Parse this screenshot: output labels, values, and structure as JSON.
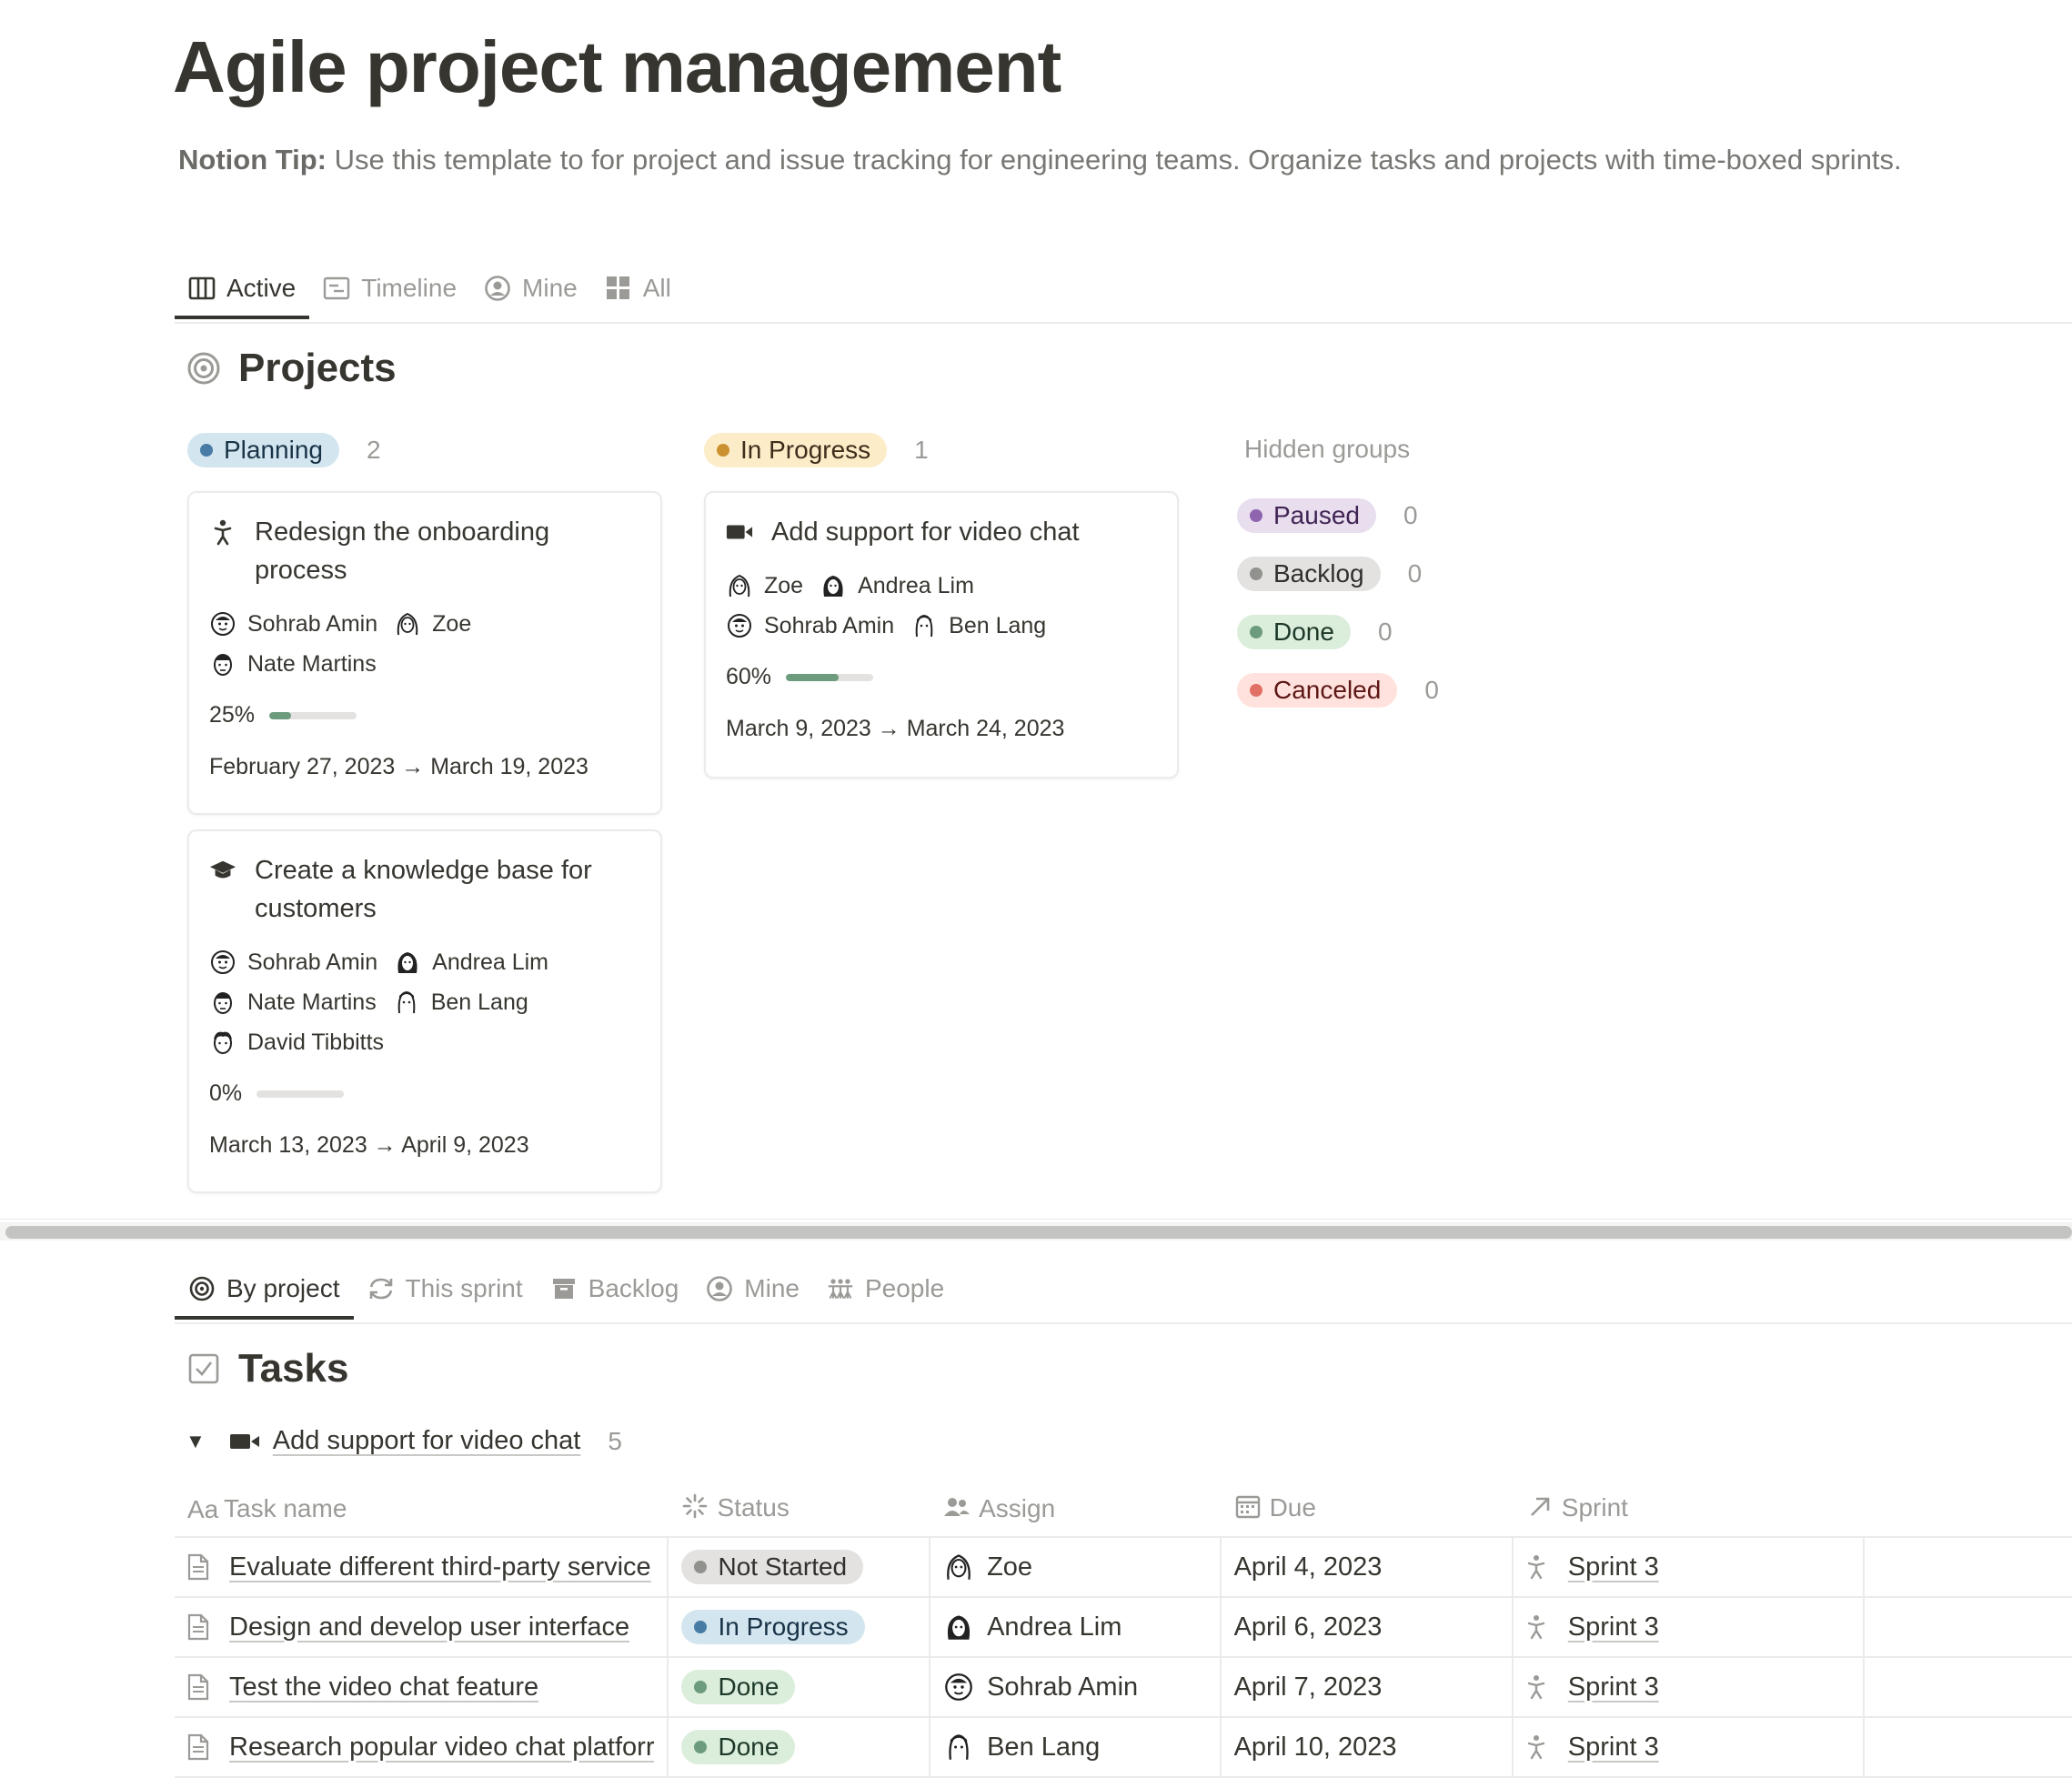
{
  "page": {
    "title": "Agile project management",
    "tip_label": "Notion Tip:",
    "tip_text": " Use this template to for project and issue tracking for engineering teams. Organize tasks and projects with time-boxed sprints."
  },
  "project_tabs": [
    {
      "label": "Active",
      "icon": "board-icon",
      "active": true
    },
    {
      "label": "Timeline",
      "icon": "timeline-icon",
      "active": false
    },
    {
      "label": "Mine",
      "icon": "user-circle-icon",
      "active": false
    },
    {
      "label": "All",
      "icon": "grid-icon",
      "active": false
    }
  ],
  "projects": {
    "title": "Projects",
    "icon": "target-icon",
    "groups": [
      {
        "name": "Planning",
        "count": "2",
        "color": "#d3e5ef",
        "dot": "#487ca5",
        "text_color": "#183347",
        "cards": [
          {
            "title": "Redesign the onboarding process",
            "icon": "person-icon",
            "people": [
              "Sohrab Amin",
              "Zoe",
              "Nate Martins"
            ],
            "progress_label": "25%",
            "progress": 0.25,
            "dates": "February 27, 2023 → March 19, 2023"
          },
          {
            "title": "Create a knowledge base for customers",
            "icon": "graduation-cap-icon",
            "people": [
              "Sohrab Amin",
              "Andrea Lim",
              "Nate Martins",
              "Ben Lang",
              "David Tibbitts"
            ],
            "progress_label": "0%",
            "progress": 0,
            "dates": "March 13, 2023 → April 9, 2023"
          }
        ]
      },
      {
        "name": "In Progress",
        "count": "1",
        "color": "#fdecc8",
        "dot": "#cb912f",
        "text_color": "#402c1b",
        "cards": [
          {
            "title": "Add support for video chat",
            "icon": "video-camera-icon",
            "people": [
              "Zoe",
              "Andrea Lim",
              "Sohrab Amin",
              "Ben Lang"
            ],
            "progress_label": "60%",
            "progress": 0.6,
            "dates": "March 9, 2023 → March 24, 2023"
          }
        ]
      }
    ],
    "hidden_label": "Hidden groups",
    "hidden_groups": [
      {
        "name": "Paused",
        "count": "0",
        "color": "#e8deee",
        "dot": "#9065b0",
        "text_color": "#412454"
      },
      {
        "name": "Backlog",
        "count": "0",
        "color": "#e3e2e0",
        "dot": "#91918e",
        "text_color": "#32302c"
      },
      {
        "name": "Done",
        "count": "0",
        "color": "#dbeddb",
        "dot": "#6c9b7d",
        "text_color": "#1c3829"
      },
      {
        "name": "Canceled",
        "count": "0",
        "color": "#ffe2dd",
        "dot": "#e16f64",
        "text_color": "#5d1715"
      }
    ]
  },
  "task_tabs": [
    {
      "label": "By project",
      "icon": "target-icon",
      "active": true
    },
    {
      "label": "This sprint",
      "icon": "refresh-icon",
      "active": false
    },
    {
      "label": "Backlog",
      "icon": "archive-icon",
      "active": false
    },
    {
      "label": "Mine",
      "icon": "user-circle-icon",
      "active": false
    },
    {
      "label": "People",
      "icon": "people-icon",
      "active": false
    }
  ],
  "tasks": {
    "title": "Tasks",
    "icon": "checkbox-icon",
    "group": {
      "name": "Add support for video chat",
      "count": "5",
      "icon": "video-camera-icon"
    },
    "columns": [
      {
        "label": "Task name",
        "icon": "Aa"
      },
      {
        "label": "Status",
        "icon": "status-icon"
      },
      {
        "label": "Assign",
        "icon": "people-icon"
      },
      {
        "label": "Due",
        "icon": "calendar-icon"
      },
      {
        "label": "Sprint",
        "icon": "relation-arrow-icon"
      }
    ],
    "rows": [
      {
        "name": "Evaluate different third-party service",
        "status": "Not Started",
        "status_bg": "#e3e2e0",
        "status_dot": "#91918e",
        "status_fg": "#32302c",
        "assignee": "Zoe",
        "due": "April 4, 2023",
        "sprint": "Sprint 3"
      },
      {
        "name": "Design and develop user interface",
        "status": "In Progress",
        "status_bg": "#d3e5ef",
        "status_dot": "#487ca5",
        "status_fg": "#183347",
        "assignee": "Andrea Lim",
        "due": "April 6, 2023",
        "sprint": "Sprint 3"
      },
      {
        "name": "Test the video chat feature",
        "status": "Done",
        "status_bg": "#dbeddb",
        "status_dot": "#6c9b7d",
        "status_fg": "#1c3829",
        "assignee": "Sohrab Amin",
        "due": "April 7, 2023",
        "sprint": "Sprint 3"
      },
      {
        "name": "Research popular video chat platforr",
        "status": "Done",
        "status_bg": "#dbeddb",
        "status_dot": "#6c9b7d",
        "status_fg": "#1c3829",
        "assignee": "Ben Lang",
        "due": "April 10, 2023",
        "sprint": "Sprint 3"
      }
    ]
  }
}
